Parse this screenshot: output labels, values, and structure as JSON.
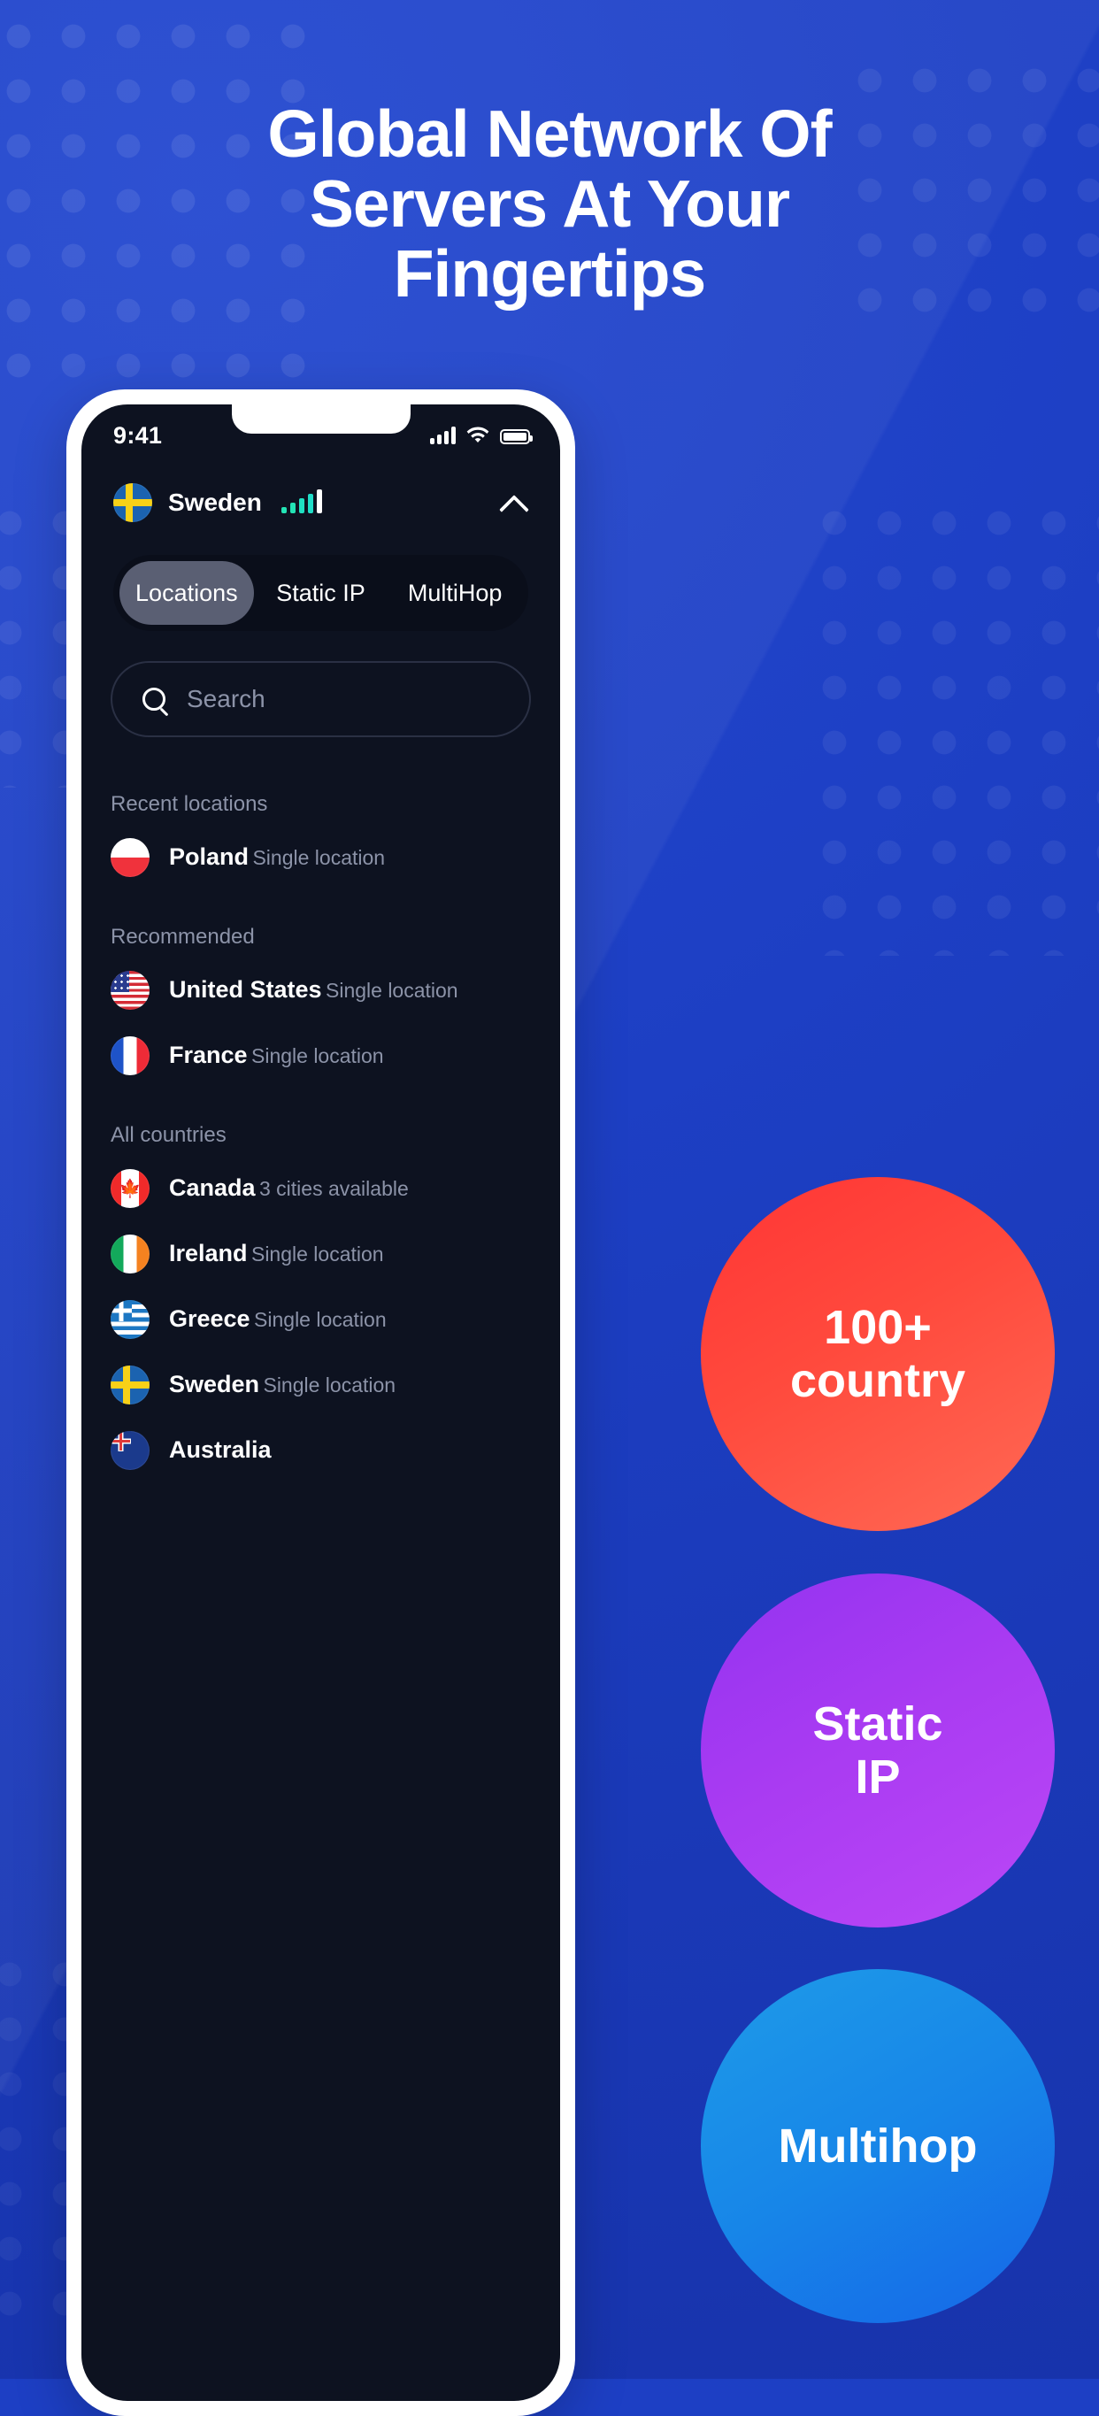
{
  "headline": {
    "line1": "Global Network Of",
    "line2": "Servers At Your",
    "line3": "Fingertips"
  },
  "colors": {
    "background": "#1D3FC4",
    "screen": "#0D1220",
    "accent_teal": "#23E3B5",
    "badge_red": "#FF4A3D",
    "badge_purple": "#A93BF2",
    "badge_blue": "#1786E8",
    "muted_text": "#8C93A8"
  },
  "phone": {
    "status_bar": {
      "time": "9:41",
      "cellular_icon": "cellular-bars-icon",
      "wifi_icon": "wifi-icon",
      "battery_icon": "battery-full-icon"
    },
    "header": {
      "flag_icon": "flag-sweden-icon",
      "country": "Sweden",
      "signal_icon": "connection-strength-icon",
      "collapse_icon": "chevron-up-icon"
    },
    "tabs": [
      {
        "label": "Locations",
        "active": true
      },
      {
        "label": "Static IP",
        "active": false
      },
      {
        "label": "MultiHop",
        "active": false
      }
    ],
    "search": {
      "icon": "search-icon",
      "placeholder": "Search",
      "value": ""
    },
    "sections": [
      {
        "title": "Recent locations",
        "items": [
          {
            "name": "Poland",
            "sub": "Single location",
            "flag": "f-pl",
            "flag_icon": "flag-poland-icon"
          }
        ]
      },
      {
        "title": "Recommended",
        "items": [
          {
            "name": "United States",
            "sub": "Single location",
            "flag": "f-us",
            "flag_icon": "flag-united-states-icon"
          },
          {
            "name": "France",
            "sub": "Single location",
            "flag": "f-fr",
            "flag_icon": "flag-france-icon"
          }
        ]
      },
      {
        "title": "All countries",
        "items": [
          {
            "name": "Canada",
            "sub": "3 cities available",
            "flag": "f-ca",
            "flag_icon": "flag-canada-icon"
          },
          {
            "name": "Ireland",
            "sub": "Single location",
            "flag": "f-ie",
            "flag_icon": "flag-ireland-icon"
          },
          {
            "name": "Greece",
            "sub": "Single location",
            "flag": "f-gr",
            "flag_icon": "flag-greece-icon"
          },
          {
            "name": "Sweden",
            "sub": "Single location",
            "flag": "f-se",
            "flag_icon": "flag-sweden-icon"
          },
          {
            "name": "Australia",
            "sub": "",
            "flag": "f-au",
            "flag_icon": "flag-australia-icon"
          }
        ]
      }
    ]
  },
  "badges": [
    {
      "id": "countries",
      "line1": "100+",
      "line2": "country"
    },
    {
      "id": "staticip",
      "line1": "Static",
      "line2": "IP"
    },
    {
      "id": "multihop",
      "line1": "Multihop",
      "line2": ""
    }
  ]
}
